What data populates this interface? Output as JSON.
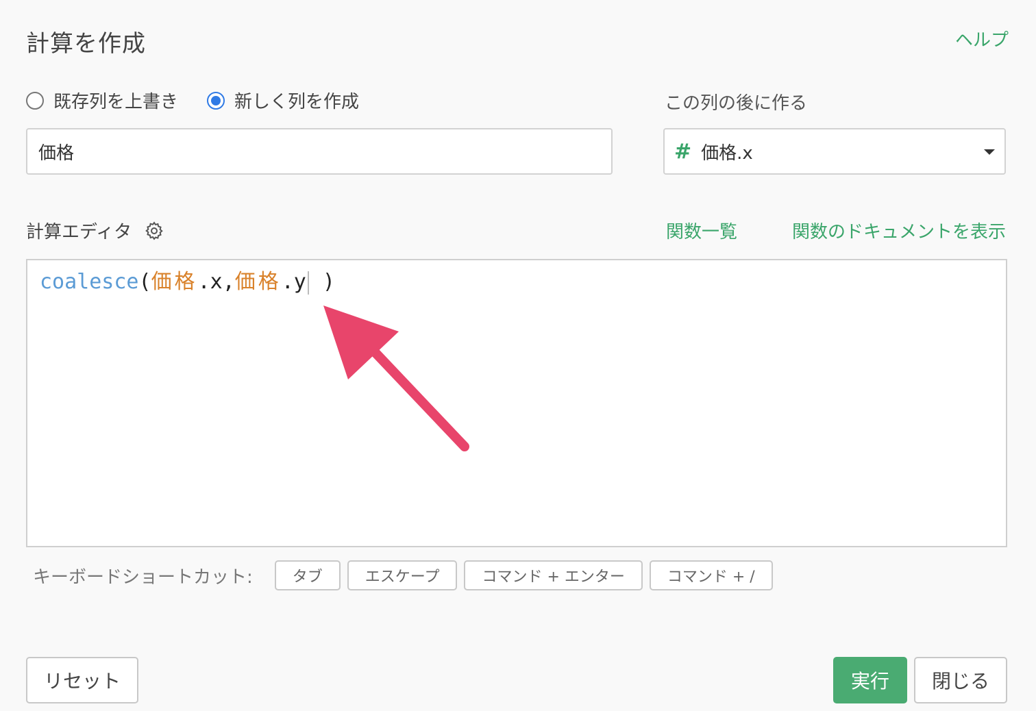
{
  "dialog": {
    "title": "計算を作成",
    "help_label": "ヘルプ"
  },
  "mode": {
    "options": [
      {
        "label": "既存列を上書き",
        "selected": false
      },
      {
        "label": "新しく列を作成",
        "selected": true
      }
    ]
  },
  "column_name": {
    "value": "価格"
  },
  "position": {
    "label": "この列の後に作る",
    "type_icon": "#",
    "selected": "価格.x"
  },
  "editor": {
    "label": "計算エディタ",
    "functions_link": "関数一覧",
    "docs_link": "関数のドキュメントを表示",
    "code": {
      "fn": "coalesce",
      "open": "(",
      "col1": "価格",
      "suffix1": ".x",
      "comma": ",",
      "col2": "価格",
      "suffix2": ".y",
      "close": " )"
    }
  },
  "shortcuts": {
    "label": "キーボードショートカット:",
    "keys": [
      "タブ",
      "エスケープ",
      "コマンド + エンター",
      "コマンド + /"
    ]
  },
  "footer": {
    "reset_label": "リセット",
    "run_label": "実行",
    "close_label": "閉じる"
  },
  "colors": {
    "accent_green": "#4aab72",
    "link_green": "#3aa56a",
    "radio_blue": "#2f7ae5",
    "arrow_pink": "#e8456b"
  }
}
